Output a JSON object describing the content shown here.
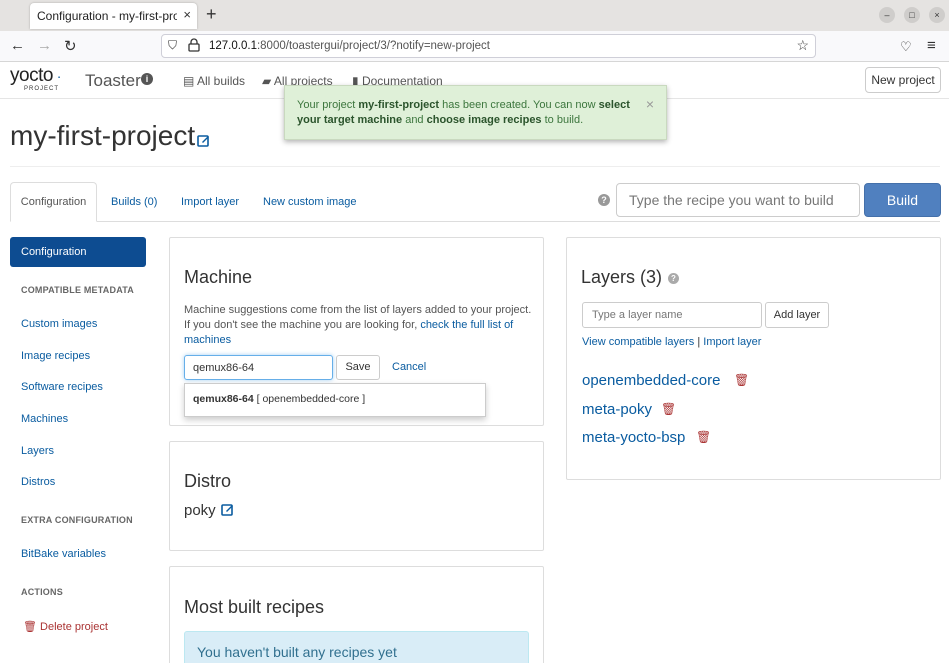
{
  "browser": {
    "tab_title": "Configuration - my-first-project",
    "tab_close": "×",
    "new_tab": "+",
    "url_host": "127.0.0.1",
    "url_rest": ":8000/toastergui/project/3/?notify=new-project",
    "win_min": "–",
    "win_max": "□",
    "win_close": "×"
  },
  "header": {
    "logo": "yocto",
    "logo_sub": "PROJECT",
    "brand": "Toaster",
    "brand_info": "i",
    "nav": [
      "All builds",
      "All projects",
      "Documentation"
    ],
    "new_project": "New project"
  },
  "notification": {
    "part1": "Your project ",
    "project": "my-first-project",
    "part2": " has been created. You can now ",
    "bold1": "select your target machine",
    "part3": " and ",
    "bold2": "choose image recipes",
    "part4": " to build.",
    "close": "×"
  },
  "project": {
    "title": "my-first-project"
  },
  "tabs": {
    "configuration": "Configuration",
    "builds": "Builds (0)",
    "import_layer": "Import layer",
    "new_custom_image": "New custom image",
    "help": "?",
    "recipe_placeholder": "Type the recipe you want to build",
    "build": "Build"
  },
  "sidebar": {
    "active": "Configuration",
    "compatible_metadata": "COMPATIBLE METADATA",
    "links": [
      "Custom images",
      "Image recipes",
      "Software recipes",
      "Machines",
      "Layers",
      "Distros"
    ],
    "extra_configuration": "EXTRA CONFIGURATION",
    "bitbake_variables": "BitBake variables",
    "actions": "ACTIONS",
    "delete_project": "Delete project"
  },
  "machine": {
    "heading": "Machine",
    "desc": "Machine suggestions come from the list of layers added to your project. If you don't see the machine you are looking for, ",
    "desc_link": "check the full list of machines",
    "value": "qemux86-64",
    "save": "Save",
    "cancel": "Cancel",
    "suggestion_name": "qemux86-64",
    "suggestion_layer": " [ openembedded-core ]"
  },
  "distro": {
    "heading": "Distro",
    "value": "poky"
  },
  "most_built": {
    "heading": "Most built recipes",
    "empty": "You haven't built any recipes yet"
  },
  "layers": {
    "heading": "Layers (3)",
    "help": "?",
    "placeholder": "Type a layer name",
    "add": "Add layer",
    "view_compatible": "View compatible layers",
    "separator": " | ",
    "import": "Import layer",
    "items": [
      "openembedded-core",
      "meta-poky",
      "meta-yocto-bsp"
    ]
  },
  "colors": {
    "link": "#0a5ca0",
    "active_nav": "#0d4c91",
    "build_button": "#5080bf",
    "success_bg": "#dff0d8",
    "info_bg": "#d9edf7",
    "danger": "#aa3333"
  }
}
